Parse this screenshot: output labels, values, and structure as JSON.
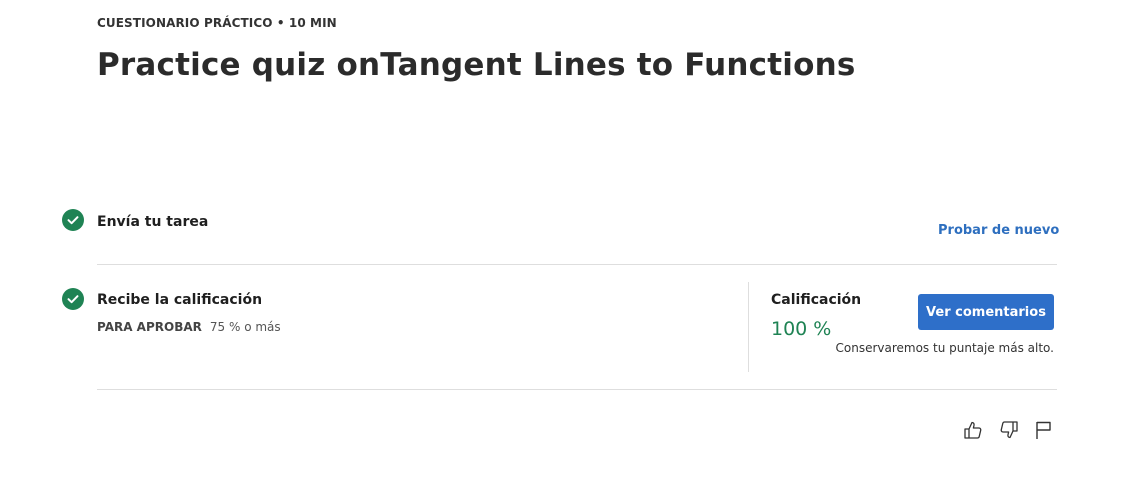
{
  "header": {
    "eyebrow": "CUESTIONARIO PRÁCTICO • 10 MIN",
    "title": "Practice quiz onTangent Lines to Functions"
  },
  "steps": [
    {
      "title": "Envía tu tarea",
      "status": "complete",
      "action_label": "Probar de nuevo"
    },
    {
      "title": "Recibe la calificación",
      "status": "complete",
      "pass_label": "PARA APROBAR",
      "pass_value": "75 % o más"
    }
  ],
  "grade": {
    "label": "Calificación",
    "value": "100 %",
    "button_label": "Ver comentarios",
    "note": "Conservaremos tu puntaje más alto."
  },
  "feedback": {
    "icons": [
      "thumbs-up-icon",
      "thumbs-down-icon",
      "flag-icon"
    ]
  },
  "colors": {
    "success": "#1f8354",
    "link": "#2e6fbf",
    "button": "#2e6fc9"
  }
}
